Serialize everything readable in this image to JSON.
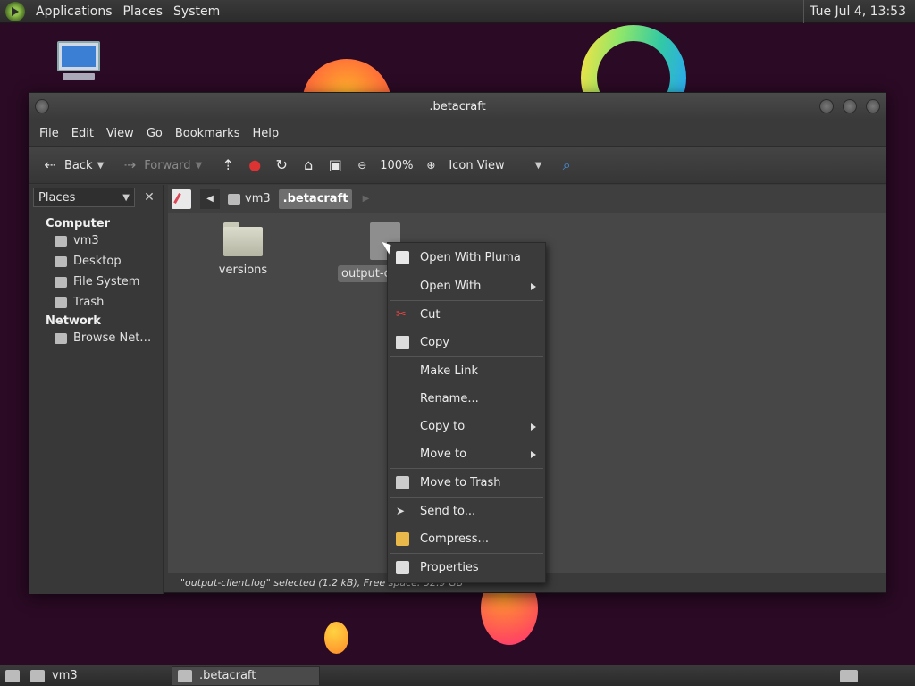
{
  "top_panel": {
    "menus": [
      "Applications",
      "Places",
      "System"
    ],
    "clock": "Tue Jul  4, 13:53"
  },
  "window": {
    "title": ".betacraft",
    "menubar": [
      "File",
      "Edit",
      "View",
      "Go",
      "Bookmarks",
      "Help"
    ],
    "toolbar": {
      "back_label": "Back",
      "forward_label": "Forward",
      "zoom_label": "100%",
      "view_label": "Icon View"
    },
    "sidebar": {
      "combo_label": "Places",
      "sections": [
        {
          "title": "Computer",
          "items": [
            "vm3",
            "Desktop",
            "File System",
            "Trash"
          ]
        },
        {
          "title": "Network",
          "items": [
            "Browse Net…"
          ]
        }
      ]
    },
    "pathbar": {
      "segments": [
        "vm3",
        ".betacraft"
      ]
    },
    "files": [
      {
        "name": "versions",
        "type": "folder"
      },
      {
        "name": "output-c",
        "type": "file",
        "selected": true
      }
    ],
    "status": "\"output-client.log\" selected (1.2 kB), Free space: 32.9 GB"
  },
  "context_menu": {
    "items": [
      {
        "label": "Open With Pluma",
        "icon": "pluma-icon"
      },
      {
        "label": "Open With",
        "submenu": true
      },
      {
        "label": "Cut",
        "icon": "scissors-icon"
      },
      {
        "label": "Copy",
        "icon": "copy-icon"
      },
      {
        "label": "Make Link"
      },
      {
        "label": "Rename..."
      },
      {
        "label": "Copy to",
        "submenu": true
      },
      {
        "label": "Move to",
        "submenu": true
      },
      {
        "label": "Move to Trash",
        "icon": "trash-icon"
      },
      {
        "label": "Send to...",
        "icon": "send-icon"
      },
      {
        "label": "Compress...",
        "icon": "archive-icon"
      },
      {
        "label": "Properties",
        "icon": "properties-icon"
      }
    ]
  },
  "taskbar": {
    "tasks": [
      "vm3",
      ".betacraft"
    ]
  }
}
